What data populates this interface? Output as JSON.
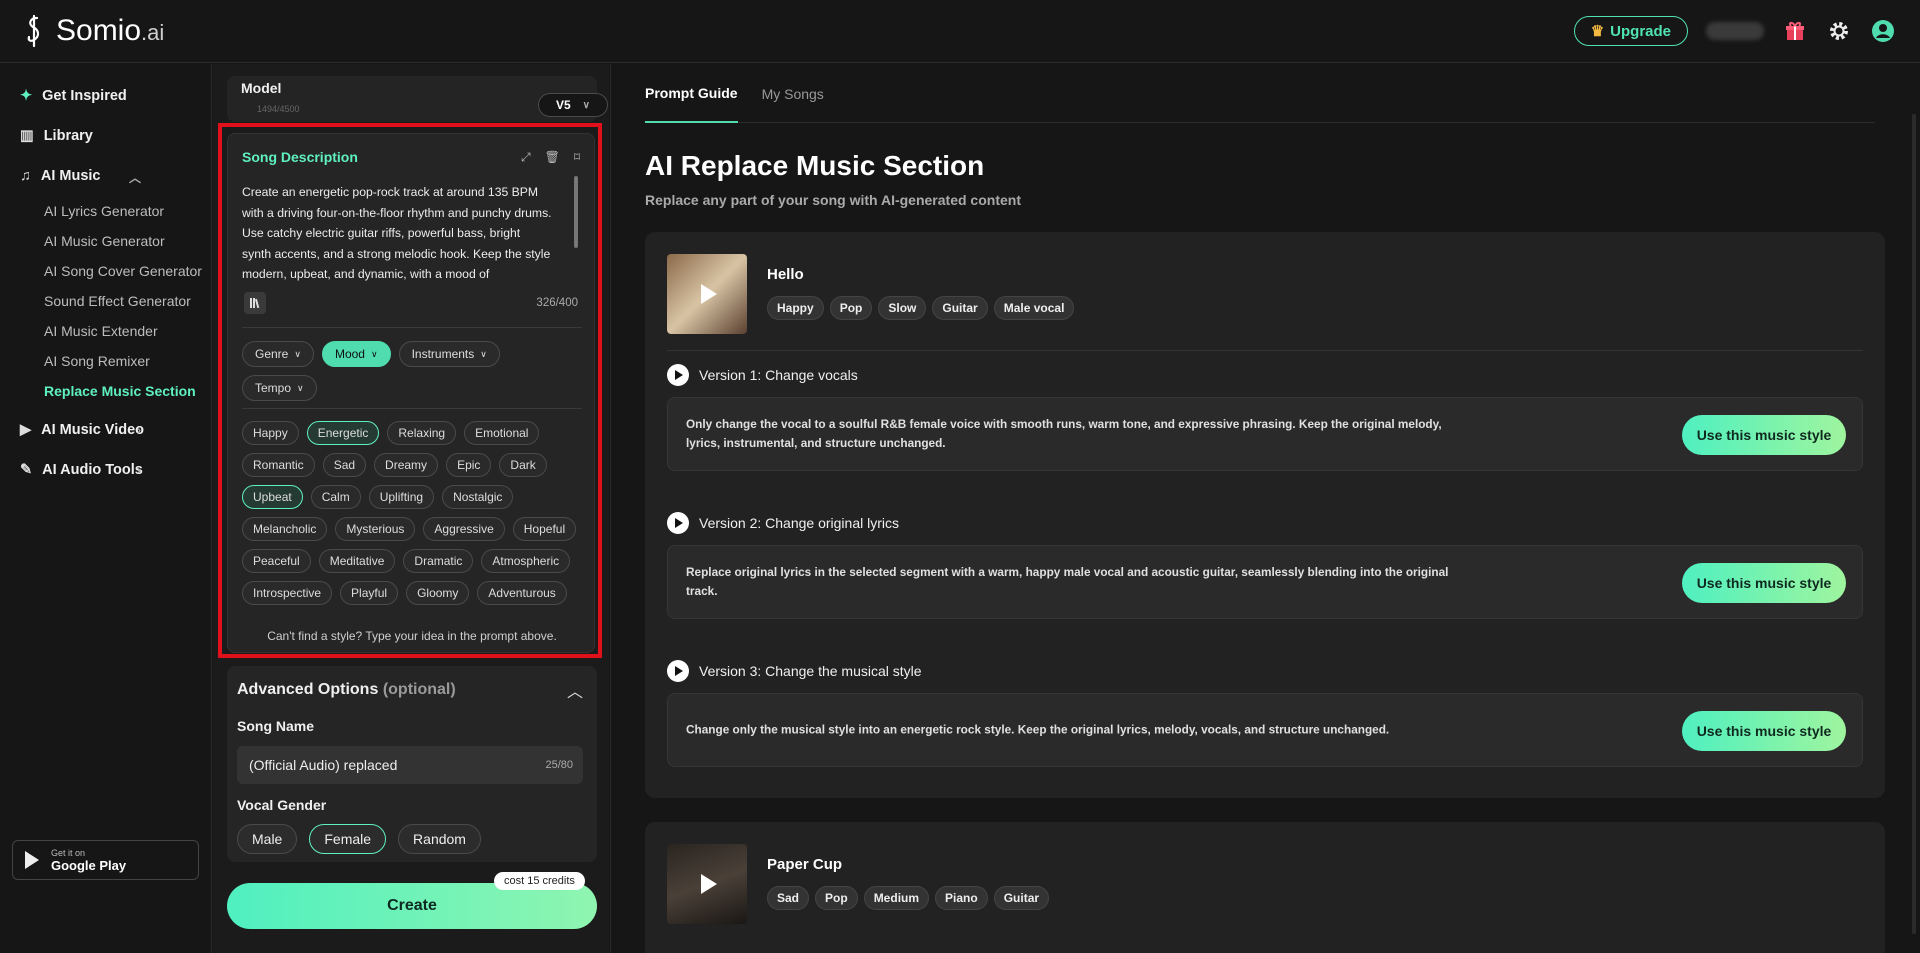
{
  "header": {
    "logo_text": "Somio",
    "logo_suffix": ".ai",
    "upgrade_label": "Upgrade"
  },
  "sidebar": {
    "items": [
      {
        "label": "Get Inspired"
      },
      {
        "label": "Library"
      },
      {
        "label": "AI Music"
      }
    ],
    "sub_items": [
      {
        "label": "AI Lyrics Generator"
      },
      {
        "label": "AI Music Generator"
      },
      {
        "label": "AI Song Cover Generator"
      },
      {
        "label": "Sound Effect Generator"
      },
      {
        "label": "AI Music Extender"
      },
      {
        "label": "AI Song Remixer"
      },
      {
        "label": "Replace Music Section"
      }
    ],
    "bottom_items": [
      {
        "label": "AI Music Video"
      },
      {
        "label": "AI Audio Tools"
      }
    ],
    "gplay_small": "Get it on",
    "gplay_big": "Google Play"
  },
  "panel": {
    "model_label": "Model",
    "model_faded": "1494/4500",
    "model_value": "V5",
    "desc_title": "Song Description",
    "desc_text": "Create an energetic pop-rock track at around 135 BPM with a driving four-on-the-floor rhythm and punchy drums. Use catchy electric guitar riffs, powerful bass, bright synth accents, and a strong melodic hook. Keep the style modern, upbeat, and dynamic, with a mood of",
    "desc_counter": "326/400",
    "filters": [
      "Genre",
      "Mood",
      "Instruments",
      "Tempo"
    ],
    "tags": [
      "Happy",
      "Energetic",
      "Relaxing",
      "Emotional",
      "Romantic",
      "Sad",
      "Dreamy",
      "Epic",
      "Dark",
      "Upbeat",
      "Calm",
      "Uplifting",
      "Nostalgic",
      "Melancholic",
      "Mysterious",
      "Aggressive",
      "Hopeful",
      "Peaceful",
      "Meditative",
      "Dramatic",
      "Atmospheric",
      "Introspective",
      "Playful",
      "Gloomy",
      "Adventurous"
    ],
    "desc_footer": "Can't find a style? Type your idea in the prompt above.",
    "adv_title": "Advanced Options",
    "adv_optional": "(optional)",
    "song_name_label": "Song Name",
    "song_name_value": "(Official Audio) replaced",
    "song_name_count": "25/80",
    "vocal_gender_label": "Vocal Gender",
    "genders": [
      "Male",
      "Female",
      "Random"
    ],
    "create_label": "Create",
    "cost_label": "cost 15 credits"
  },
  "main": {
    "tabs": [
      "Prompt Guide",
      "My Songs"
    ],
    "title": "AI Replace Music Section",
    "subtitle": "Replace any part of your song with AI-generated content",
    "use_label": "Use this music style",
    "songs": [
      {
        "title": "Hello",
        "tags": [
          "Happy",
          "Pop",
          "Slow",
          "Guitar",
          "Male vocal"
        ],
        "versions": [
          {
            "head": "Version 1: Change vocals",
            "text": "Only change the vocal to a soulful R&B female voice with smooth runs, warm tone, and expressive phrasing. Keep the original melody, lyrics, instrumental, and structure unchanged."
          },
          {
            "head": "Version 2: Change original lyrics",
            "text": "Replace original lyrics in the selected segment with a warm, happy male vocal and acoustic guitar, seamlessly blending into the original track."
          },
          {
            "head": "Version 3: Change the musical style",
            "text": "Change only the musical style into an energetic rock style. Keep the original lyrics, melody, vocals, and structure unchanged."
          }
        ]
      },
      {
        "title": "Paper Cup",
        "tags": [
          "Sad",
          "Pop",
          "Medium",
          "Piano",
          "Guitar"
        ]
      }
    ]
  },
  "colors": {
    "accent": "#4fdcae",
    "highlight": "#e2101a"
  }
}
